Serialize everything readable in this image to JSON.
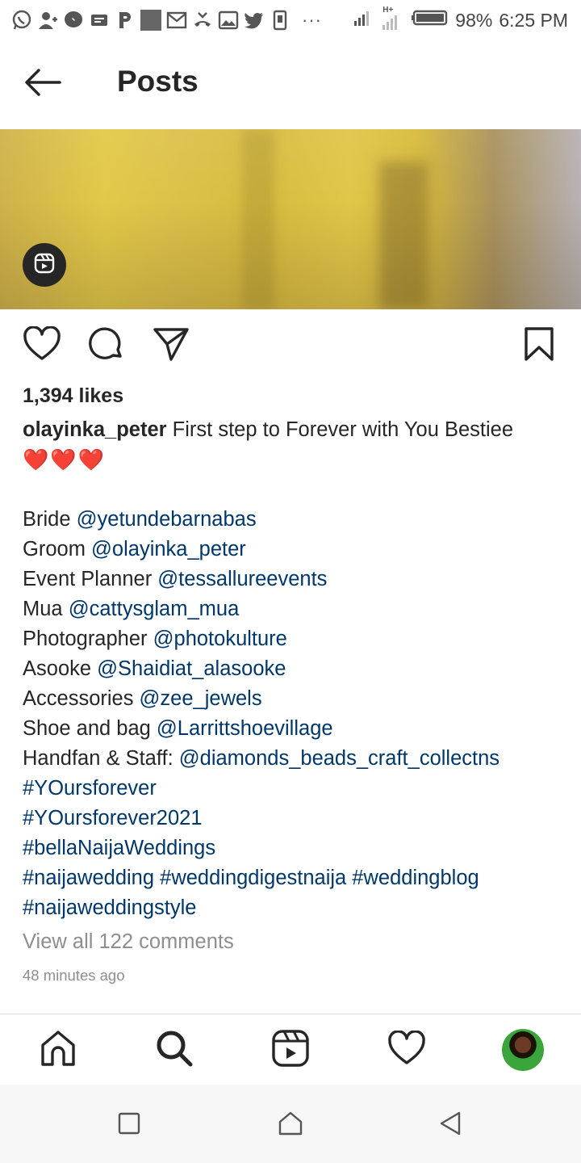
{
  "status_bar": {
    "battery_percent": "98%",
    "time": "6:25 PM",
    "overflow": "···",
    "network_label": "H+",
    "left_icons": [
      "whatsapp-icon",
      "add-contact-icon",
      "messenger-icon",
      "message-icon",
      "p-icon",
      "gray-square-icon",
      "gmail-icon",
      "missed-call-icon",
      "gallery-icon",
      "twitter-icon",
      "phone-storage-icon"
    ]
  },
  "header": {
    "title": "Posts",
    "back_icon": "arrow-left-icon"
  },
  "post": {
    "media_badge_icon": "reels-icon",
    "likes": "1,394 likes",
    "caption": {
      "username": "olayinka_peter",
      "text": " First step to Forever with You Bestiee",
      "emoji": "❤️❤️❤️",
      "credits": [
        {
          "label": "Bride ",
          "handle": "@yetundebarnabas"
        },
        {
          "label": "Groom ",
          "handle": "@olayinka_peter"
        },
        {
          "label": "Event Planner ",
          "handle": "@tessallureevents"
        },
        {
          "label": "Mua ",
          "handle": "@cattysglam_mua"
        },
        {
          "label": "Photographer ",
          "handle": "@photokulture"
        },
        {
          "label": "Asooke ",
          "handle": "@Shaidiat_alasooke"
        },
        {
          "label": "Accessories ",
          "handle": "@zee_jewels"
        },
        {
          "label": "Shoe and bag ",
          "handle": "@Larrittshoevillage"
        },
        {
          "label": "Handfan & Staff: ",
          "handle": "@diamonds_beads_craft_collectns"
        }
      ],
      "hashtag_lines": [
        "#YOursforever",
        "#YOursforever2021",
        "#bellaNaijaWeddings",
        "#naijawedding #weddingdigestnaija #weddingblog",
        "#naijaweddingstyle"
      ]
    },
    "view_comments": "View all 122 comments",
    "timestamp": "48 minutes ago",
    "actions": [
      "heart-icon",
      "comment-icon",
      "share-icon",
      "bookmark-icon"
    ]
  },
  "bottom_nav": [
    "home-icon",
    "search-icon",
    "reels-icon",
    "activity-heart-icon",
    "profile-avatar"
  ],
  "system_nav": [
    "recents-square-icon",
    "home-circle-icon",
    "back-triangle-icon"
  ],
  "colors": {
    "text": "#262626",
    "link": "#00376b",
    "muted": "#8e8e8e",
    "heart_emoji": "#e0242e"
  }
}
